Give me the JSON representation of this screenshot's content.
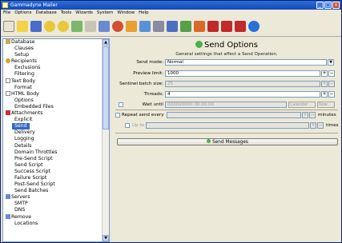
{
  "window": {
    "title": "Gammadyne Mailer"
  },
  "menu": [
    "File",
    "Options",
    "Database",
    "Tools",
    "Wizards",
    "System",
    "Window",
    "Help"
  ],
  "sidebar": {
    "items": [
      {
        "label": "Database",
        "level": 0
      },
      {
        "label": "Clauses",
        "level": 1
      },
      {
        "label": "Setup",
        "level": 1
      },
      {
        "label": "Recipients",
        "level": 0
      },
      {
        "label": "Exclusions",
        "level": 1
      },
      {
        "label": "Filtering",
        "level": 1
      },
      {
        "label": "Text Body",
        "level": 0
      },
      {
        "label": "Format",
        "level": 1
      },
      {
        "label": "HTML Body",
        "level": 0
      },
      {
        "label": "Options",
        "level": 1
      },
      {
        "label": "Embedded Files",
        "level": 1
      },
      {
        "label": "Attachments",
        "level": 0
      },
      {
        "label": "Explicit",
        "level": 1
      },
      {
        "label": "Send",
        "level": 1,
        "selected": true
      },
      {
        "label": "Delivery",
        "level": 1
      },
      {
        "label": "Logging",
        "level": 1
      },
      {
        "label": "Details",
        "level": 1
      },
      {
        "label": "Domain Throttles",
        "level": 1
      },
      {
        "label": "Pre-Send Script",
        "level": 1
      },
      {
        "label": "Send Script",
        "level": 1
      },
      {
        "label": "Success Script",
        "level": 1
      },
      {
        "label": "Failure Script",
        "level": 1
      },
      {
        "label": "Post-Send Script",
        "level": 1
      },
      {
        "label": "Send Batches",
        "level": 1
      },
      {
        "label": "Servers",
        "level": 0
      },
      {
        "label": "SMTP",
        "level": 1
      },
      {
        "label": "DNS",
        "level": 1
      },
      {
        "label": "Remove",
        "level": 0
      },
      {
        "label": "Locations",
        "level": 1
      }
    ]
  },
  "main": {
    "title": "Send Options",
    "subtitle": "General settings that affect a Send Operation.",
    "send_mode": {
      "label": "Send mode:",
      "value": "Normal"
    },
    "preview_limit": {
      "label": "Preview limit:",
      "value": "1000"
    },
    "sentinel_batch": {
      "label": "Sentinel batch size:",
      "value": "25"
    },
    "threads": {
      "label": "Threads:",
      "value": "4"
    },
    "wait_until": {
      "label": "Wait until",
      "value": "00/00/0000 00:00:00",
      "calendar": "Calendar",
      "now": "Now"
    },
    "repeat": {
      "label": "Repeat send every",
      "unit": "minutes"
    },
    "upto": {
      "label": "Up to",
      "unit": "times"
    },
    "send_button": "Send Messages"
  }
}
